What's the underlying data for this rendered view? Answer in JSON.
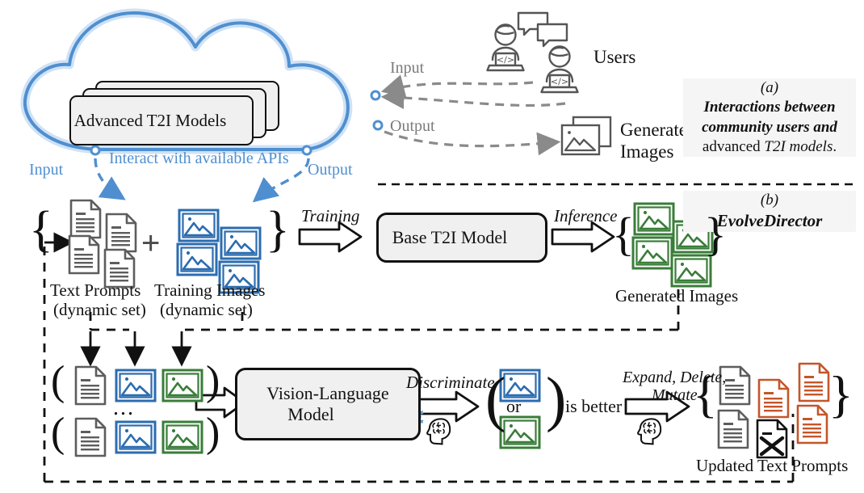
{
  "figure": {
    "title_a_tag": "(a)",
    "title_b_tag": "(b)"
  },
  "cloud_section": {
    "models_box_label": "Advanced T2I Models",
    "models_lock_icon": "lock-icon",
    "api_label": "Interact with available APIs",
    "cloud_input_label": "Input",
    "cloud_output_label": "Output",
    "user_input_label": "Input",
    "user_output_label": "Output",
    "users_label": "Users",
    "generated_images_label_line1": "Generated",
    "generated_images_label_line2": "Images",
    "user_icon_left": "user-laptop-icon",
    "user_icon_right": "user-laptop-icon",
    "chat_icon": "chat-bubbles-icon",
    "image_stack_icon": "image-stack-icon"
  },
  "panel_a": {
    "tag": "(a)",
    "line1": "Interactions between",
    "line2": "community users and",
    "line3_plain": "advanced ",
    "line3_ital": "T2I models",
    "line3_end": "."
  },
  "panel_b": {
    "tag": "(b)",
    "name": "EvolveDirector"
  },
  "training_row": {
    "brace_open": "{",
    "brace_close": "}",
    "plus": "+",
    "text_prompts_line1": "Text Prompts",
    "text_prompts_line2": "(dynamic set)",
    "training_images_line1": "Training Images",
    "training_images_line2": "(dynamic set)",
    "training_arrow_label": "Training",
    "base_model_label": "Base T2I Model",
    "base_model_icon": "fire-icon",
    "inference_arrow_label": "Inference",
    "generated_images_label": "Generated Images",
    "gen_brace_open": "{",
    "gen_brace_close": "}",
    "doc_icon": "document-icon",
    "image_icon_blue": "image-icon",
    "image_icon_green": "image-icon"
  },
  "vlm_row": {
    "ellipsis": "...",
    "vlm_label_line1": "Vision-Language",
    "vlm_label_line2": "Model",
    "vlm_icon": "snowflake-icon",
    "discriminate_label": "Discriminate",
    "discriminate_icon": "brain-head-icon",
    "or_label": "or",
    "is_better_label": "is better",
    "mutate_label_line1": "Expand, Delete,",
    "mutate_label_line2": "Mutate",
    "mutate_icon": "brain-head-icon",
    "updated_prompts_label": "Updated Text Prompts",
    "paren_open": "(",
    "paren_close": ")",
    "brace_open": "{",
    "brace_close": "}",
    "deleted_doc_icon": "document-deleted-icon"
  },
  "colors": {
    "blue": "#4f8fd0",
    "blue_dark": "#2e6da4",
    "blue_icon": "#2b6cb0",
    "green": "#3a7d3a",
    "orange": "#c4562a",
    "gray": "#7b7b7b",
    "gray_dark": "#4a4a4a",
    "fire_red": "#b52a1e",
    "panel_bg": "#f5f5f5",
    "box_bg": "#f0f0f0",
    "ink": "#111111"
  }
}
